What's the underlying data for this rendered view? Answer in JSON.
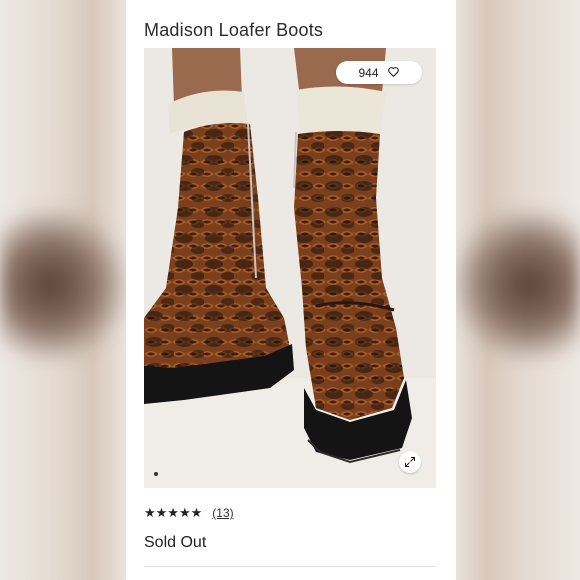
{
  "product": {
    "title": "Madison Loafer Boots",
    "likes": "944",
    "rating_stars": "★★★★★",
    "review_count": "(13)",
    "status": "Sold Out"
  },
  "icons": {
    "like": "heart-icon",
    "expand": "expand-icon",
    "carousel": "carousel-dot"
  },
  "colors": {
    "card_background": "#ffffff",
    "text": "#222222"
  }
}
